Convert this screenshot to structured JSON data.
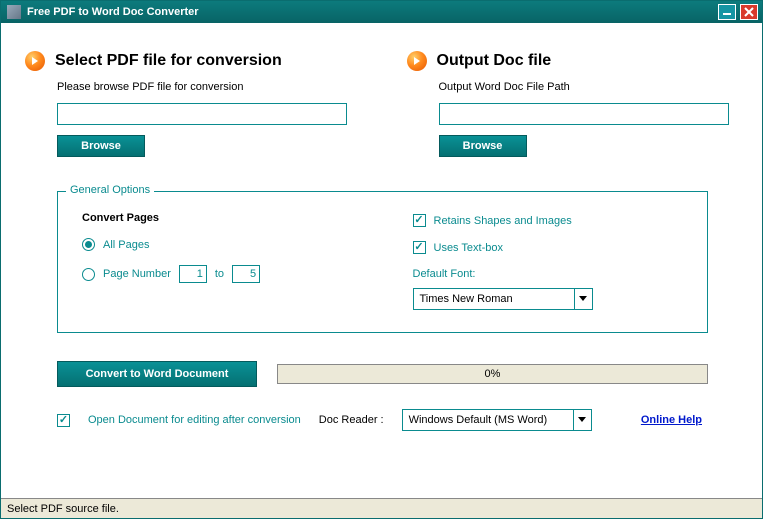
{
  "window": {
    "title": "Free PDF to Word Doc Converter"
  },
  "input_section": {
    "heading": "Select PDF file for conversion",
    "subtext": "Please browse PDF file for conversion",
    "path_value": "",
    "browse_label": "Browse"
  },
  "output_section": {
    "heading": "Output Doc file",
    "subtext": "Output Word Doc File Path",
    "path_value": "",
    "browse_label": "Browse"
  },
  "options": {
    "legend": "General Options",
    "convert_pages_title": "Convert Pages",
    "all_pages_label": "All Pages",
    "page_number_label": "Page Number",
    "page_from": "1",
    "page_to_label": "to",
    "page_to": "5",
    "retains_label": "Retains Shapes and Images",
    "textbox_label": "Uses Text-box",
    "font_label": "Default Font:",
    "font_value": "Times New Roman"
  },
  "actions": {
    "convert_label": "Convert to Word Document",
    "progress_text": "0%"
  },
  "footer": {
    "open_after_label": "Open Document for editing after conversion",
    "doc_reader_label": "Doc Reader :",
    "doc_reader_value": "Windows Default (MS Word)",
    "online_help": "Online Help"
  },
  "statusbar": "Select PDF source file."
}
